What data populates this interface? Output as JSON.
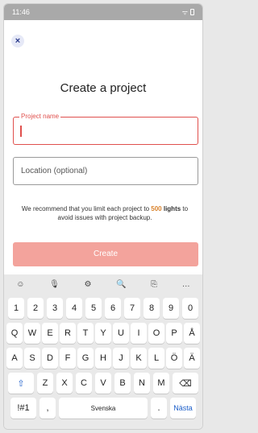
{
  "status": {
    "time": "11:46",
    "icons": "ᯤ ▮"
  },
  "close_icon": "×",
  "title": "Create a project",
  "project_name": {
    "label": "Project name",
    "value": ""
  },
  "location": {
    "placeholder": "Location (optional)"
  },
  "info": {
    "pre": "We recommend that you limit each project to ",
    "highlight": "500",
    "mid": " lights",
    "post": " to avoid issues with project backup."
  },
  "create_button": "Create",
  "keyboard": {
    "toolbar": [
      "☺",
      "🎙",
      "⚙",
      "🔍",
      "⎘",
      "…"
    ],
    "row1": [
      "1",
      "2",
      "3",
      "4",
      "5",
      "6",
      "7",
      "8",
      "9",
      "0"
    ],
    "row2": [
      "Q",
      "W",
      "E",
      "R",
      "T",
      "Y",
      "U",
      "I",
      "O",
      "P",
      "Å"
    ],
    "row3": [
      "A",
      "S",
      "D",
      "F",
      "G",
      "H",
      "J",
      "K",
      "L",
      "Ö",
      "Ä"
    ],
    "row4": [
      "Z",
      "X",
      "C",
      "V",
      "B",
      "N",
      "M"
    ],
    "shift": "⇧",
    "backspace": "⌫",
    "symbols": "!#1",
    "comma": ",",
    "space": "Svenska",
    "period": ".",
    "next": "Nästa"
  }
}
